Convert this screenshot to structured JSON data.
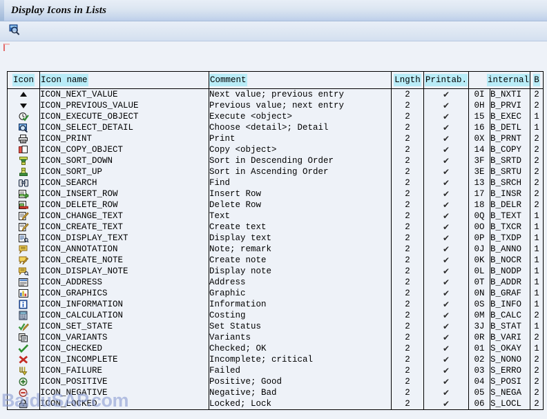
{
  "window": {
    "title": "Display Icons in Lists"
  },
  "toolbar": {
    "buttons": [
      {
        "name": "search-find-icon",
        "tooltip": "Find"
      }
    ]
  },
  "table": {
    "headers": {
      "icon": "Icon",
      "icon_name": "Icon name",
      "comment": "Comment",
      "lngth": "Lngth",
      "printable": "Printab.",
      "internal": "internal",
      "b": "B"
    },
    "rows": [
      {
        "icon": "up-triangle-icon",
        "name": "ICON_NEXT_VALUE",
        "comment": "Next value; previous entry",
        "lngth": "2",
        "printable": "✔",
        "int_code": "0I",
        "int_name": "B_NXTI",
        "b": "2"
      },
      {
        "icon": "down-triangle-icon",
        "name": "ICON_PREVIOUS_VALUE",
        "comment": "Previous value; next entry",
        "lngth": "2",
        "printable": "✔",
        "int_code": "0H",
        "int_name": "B_PRVI",
        "b": "2"
      },
      {
        "icon": "clock-check-icon",
        "name": "ICON_EXECUTE_OBJECT",
        "comment": "Execute <object>",
        "lngth": "2",
        "printable": "✔",
        "int_code": "15",
        "int_name": "B_EXEC",
        "b": "1"
      },
      {
        "icon": "magnifier-detail-icon",
        "name": "ICON_SELECT_DETAIL",
        "comment": "Choose <detail>; Detail",
        "lngth": "2",
        "printable": "✔",
        "int_code": "16",
        "int_name": "B_DETL",
        "b": "1"
      },
      {
        "icon": "printer-icon",
        "name": "ICON_PRINT",
        "comment": "Print",
        "lngth": "2",
        "printable": "✔",
        "int_code": "0X",
        "int_name": "B_PRNT",
        "b": "2"
      },
      {
        "icon": "copy-pages-icon",
        "name": "ICON_COPY_OBJECT",
        "comment": "Copy <object>",
        "lngth": "2",
        "printable": "✔",
        "int_code": "14",
        "int_name": "B_COPY",
        "b": "2"
      },
      {
        "icon": "sort-descending-icon",
        "name": "ICON_SORT_DOWN",
        "comment": "Sort in Descending Order",
        "lngth": "2",
        "printable": "✔",
        "int_code": "3F",
        "int_name": "B_SRTD",
        "b": "2"
      },
      {
        "icon": "sort-ascending-icon",
        "name": "ICON_SORT_UP",
        "comment": "Sort in Ascending Order",
        "lngth": "2",
        "printable": "✔",
        "int_code": "3E",
        "int_name": "B_SRTU",
        "b": "2"
      },
      {
        "icon": "binoculars-icon",
        "name": "ICON_SEARCH",
        "comment": "Find",
        "lngth": "2",
        "printable": "✔",
        "int_code": "13",
        "int_name": "B_SRCH",
        "b": "2"
      },
      {
        "icon": "insert-row-icon",
        "name": "ICON_INSERT_ROW",
        "comment": "Insert Row",
        "lngth": "2",
        "printable": "✔",
        "int_code": "17",
        "int_name": "B_INSR",
        "b": "2"
      },
      {
        "icon": "delete-row-icon",
        "name": "ICON_DELETE_ROW",
        "comment": "Delete Row",
        "lngth": "2",
        "printable": "✔",
        "int_code": "18",
        "int_name": "B_DELR",
        "b": "2"
      },
      {
        "icon": "change-text-pencil-icon",
        "name": "ICON_CHANGE_TEXT",
        "comment": "Text",
        "lngth": "2",
        "printable": "✔",
        "int_code": "0Q",
        "int_name": "B_TEXT",
        "b": "1"
      },
      {
        "icon": "create-text-pencil-icon",
        "name": "ICON_CREATE_TEXT",
        "comment": "Create text",
        "lngth": "2",
        "printable": "✔",
        "int_code": "0O",
        "int_name": "B_TXCR",
        "b": "1"
      },
      {
        "icon": "display-text-icon",
        "name": "ICON_DISPLAY_TEXT",
        "comment": "Display text",
        "lngth": "2",
        "printable": "✔",
        "int_code": "0P",
        "int_name": "B_TXDP",
        "b": "1"
      },
      {
        "icon": "annotation-icon",
        "name": "ICON_ANNOTATION",
        "comment": "Note; remark",
        "lngth": "2",
        "printable": "✔",
        "int_code": "0J",
        "int_name": "B_ANNO",
        "b": "1"
      },
      {
        "icon": "create-note-icon",
        "name": "ICON_CREATE_NOTE",
        "comment": "Create note",
        "lngth": "2",
        "printable": "✔",
        "int_code": "0K",
        "int_name": "B_NOCR",
        "b": "1"
      },
      {
        "icon": "display-note-icon",
        "name": "ICON_DISPLAY_NOTE",
        "comment": "Display note",
        "lngth": "2",
        "printable": "✔",
        "int_code": "0L",
        "int_name": "B_NODP",
        "b": "1"
      },
      {
        "icon": "address-card-icon",
        "name": "ICON_ADDRESS",
        "comment": "Address",
        "lngth": "2",
        "printable": "✔",
        "int_code": "0T",
        "int_name": "B_ADDR",
        "b": "1"
      },
      {
        "icon": "bar-chart-icon",
        "name": "ICON_GRAPHICS",
        "comment": "Graphic",
        "lngth": "2",
        "printable": "✔",
        "int_code": "0N",
        "int_name": "B_GRAF",
        "b": "1"
      },
      {
        "icon": "information-icon",
        "name": "ICON_INFORMATION",
        "comment": "Information",
        "lngth": "2",
        "printable": "✔",
        "int_code": "0S",
        "int_name": "B_INFO",
        "b": "1"
      },
      {
        "icon": "calculator-icon",
        "name": "ICON_CALCULATION",
        "comment": "Costing",
        "lngth": "2",
        "printable": "✔",
        "int_code": "0M",
        "int_name": "B_CALC",
        "b": "2"
      },
      {
        "icon": "set-status-icon",
        "name": "ICON_SET_STATE",
        "comment": "Set Status",
        "lngth": "2",
        "printable": "✔",
        "int_code": "3J",
        "int_name": "B_STAT",
        "b": "1"
      },
      {
        "icon": "variants-icon",
        "name": "ICON_VARIANTS",
        "comment": "Variants",
        "lngth": "2",
        "printable": "✔",
        "int_code": "0R",
        "int_name": "B_VARI",
        "b": "2"
      },
      {
        "icon": "green-check-icon",
        "name": "ICON_CHECKED",
        "comment": "Checked; OK",
        "lngth": "2",
        "printable": "✔",
        "int_code": "01",
        "int_name": "S_OKAY",
        "b": "1"
      },
      {
        "icon": "red-cross-icon",
        "name": "ICON_INCOMPLETE",
        "comment": "Incomplete; critical",
        "lngth": "2",
        "printable": "✔",
        "int_code": "02",
        "int_name": "S_NONO",
        "b": "2"
      },
      {
        "icon": "failure-arrow-icon",
        "name": "ICON_FAILURE",
        "comment": "Failed",
        "lngth": "2",
        "printable": "✔",
        "int_code": "03",
        "int_name": "S_ERRO",
        "b": "2"
      },
      {
        "icon": "plus-circle-icon",
        "name": "ICON_POSITIVE",
        "comment": "Positive; Good",
        "lngth": "2",
        "printable": "✔",
        "int_code": "04",
        "int_name": "S_POSI",
        "b": "2"
      },
      {
        "icon": "minus-circle-icon",
        "name": "ICON_NEGATIVE",
        "comment": "Negative; Bad",
        "lngth": "2",
        "printable": "✔",
        "int_code": "05",
        "int_name": "S_NEGA",
        "b": "2"
      },
      {
        "icon": "padlock-icon",
        "name": "ICON_LOCKED",
        "comment": "Locked; Lock",
        "lngth": "2",
        "printable": "✔",
        "int_code": "06",
        "int_name": "S_LOCL",
        "b": "2"
      }
    ]
  },
  "watermark": {
    "text": "BaiduSAP.com"
  },
  "colors": {
    "header_highlight": "#b9ecf7",
    "work_background": "#eef2f8",
    "titlebar": "#c9d8ec",
    "grid_line": "#000000"
  }
}
